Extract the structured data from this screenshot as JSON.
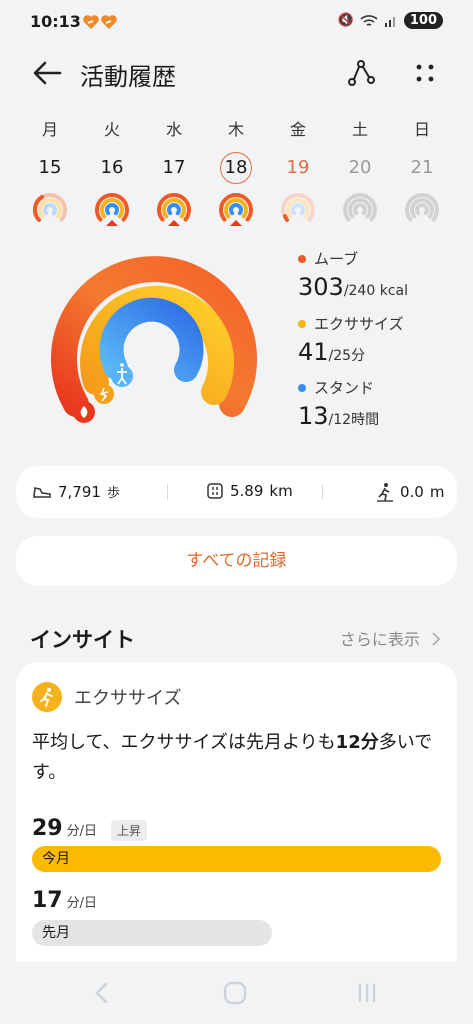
{
  "status": {
    "time": "10:13",
    "battery": "100"
  },
  "header": {
    "title": "活動履歴"
  },
  "week": [
    {
      "dow": "月",
      "num": "15",
      "state": "normal"
    },
    {
      "dow": "火",
      "num": "16",
      "state": "normal"
    },
    {
      "dow": "水",
      "num": "17",
      "state": "normal"
    },
    {
      "dow": "木",
      "num": "18",
      "state": "selected"
    },
    {
      "dow": "金",
      "num": "19",
      "state": "today"
    },
    {
      "dow": "土",
      "num": "20",
      "state": "future"
    },
    {
      "dow": "日",
      "num": "21",
      "state": "future"
    }
  ],
  "rings": {
    "move": {
      "label": "ムーブ",
      "value": "303",
      "goal": "/240 kcal",
      "color": "#ef5a28",
      "progress": 1.26
    },
    "exercise": {
      "label": "エクササイズ",
      "value": "41",
      "goal": "/25分",
      "color": "#f6b21b",
      "progress": 1.64
    },
    "stand": {
      "label": "スタンド",
      "value": "13",
      "goal": "/12時間",
      "color": "#3a8ef0",
      "progress": 1.08
    }
  },
  "stats": {
    "steps": "7,791",
    "steps_unit": "歩",
    "distance": "5.89",
    "distance_unit": "km",
    "climb": "0.0",
    "climb_unit": "m"
  },
  "records_button": "すべての記録",
  "insight": {
    "title": "インサイト",
    "more": "さらに表示",
    "category": "エクササイズ",
    "text_before": "平均して、エクササイズは先月よりも",
    "text_bold": "12分",
    "text_after": "多いです。",
    "current_value": "29",
    "current_unit": "分/日",
    "trend_badge": "上昇",
    "current_label": "今月",
    "previous_value": "17",
    "previous_unit": "分/日",
    "previous_label": "先月"
  }
}
